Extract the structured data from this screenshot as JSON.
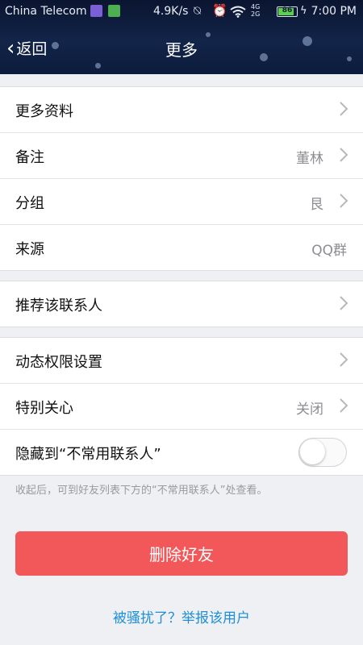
{
  "status_bar": {
    "carrier": "China Telecom",
    "speed": "4.9K/s",
    "network_label": "4G",
    "network_label_2": "2G",
    "battery": "86",
    "battery_level": 0.86,
    "time": "7:00 PM"
  },
  "nav": {
    "back_label": "返回",
    "title": "更多"
  },
  "group1": [
    {
      "label": "更多资料",
      "value": ""
    },
    {
      "label": "备注",
      "value": "董林"
    },
    {
      "label": "分组",
      "value": "艮"
    },
    {
      "label": "来源",
      "value": "QQ群"
    }
  ],
  "group2": [
    {
      "label": "推荐该联系人",
      "value": ""
    }
  ],
  "group3": [
    {
      "label": "动态权限设置",
      "value": ""
    },
    {
      "label": "特别关心",
      "value": "关闭"
    },
    {
      "label": "隐藏到“不常用联系人”",
      "toggle_on": false
    }
  ],
  "hint": "收起后，可到好友列表下方的“不常用联系人”处查看。",
  "delete_button": "删除好友",
  "report_link": "被骚扰了？举报该用户",
  "colors": {
    "header_bg": "#0d1c3d",
    "danger": "#f2585a",
    "link": "#1c8fd8"
  }
}
